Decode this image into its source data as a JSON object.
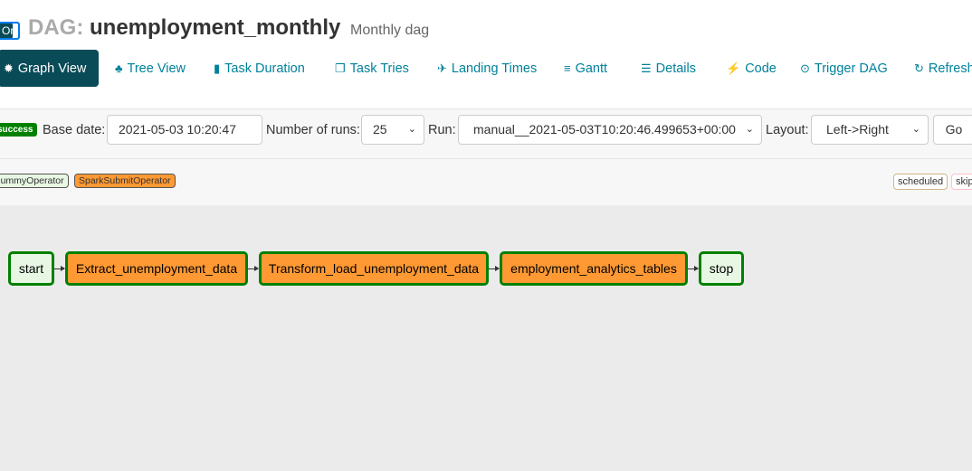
{
  "header": {
    "toggle_label": "On",
    "dag_prefix": "DAG:",
    "dag_id": "unemployment_monthly",
    "description": "Monthly dag"
  },
  "nav": {
    "items": [
      {
        "label": "Graph View",
        "icon": "gear-icon"
      },
      {
        "label": "Tree View",
        "icon": "tree-icon"
      },
      {
        "label": "Task Duration",
        "icon": "bar-chart-icon"
      },
      {
        "label": "Task Tries",
        "icon": "copy-icon"
      },
      {
        "label": "Landing Times",
        "icon": "plane-icon"
      },
      {
        "label": "Gantt",
        "icon": "align-left-icon"
      },
      {
        "label": "Details",
        "icon": "list-icon"
      },
      {
        "label": "Code",
        "icon": "bolt-icon"
      },
      {
        "label": "Trigger DAG",
        "icon": "play-circle-icon"
      },
      {
        "label": "Refresh",
        "icon": "refresh-icon"
      }
    ]
  },
  "controls": {
    "state_badge": "success",
    "base_date_label": "Base date:",
    "base_date_value": "2021-05-03 10:20:47",
    "num_runs_label": "Number of runs:",
    "num_runs_value": "25",
    "run_label": "Run:",
    "run_value": "manual__2021-05-03T10:20:46.499653+00:00",
    "layout_label": "Layout:",
    "layout_value": "Left->Right",
    "go_label": "Go"
  },
  "legend": {
    "operators": [
      {
        "label": "DummyOperator",
        "color": "#e8f7e4"
      },
      {
        "label": "SparkSubmitOperator",
        "color": "#ff9933"
      }
    ],
    "states": [
      {
        "label": "scheduled",
        "color": "#d2b48c"
      },
      {
        "label": "skipped",
        "color": "#ffc0cb"
      }
    ]
  },
  "graph": {
    "nodes": [
      {
        "label": "start",
        "color": "#e8f7e4"
      },
      {
        "label": "Extract_unemployment_data",
        "color": "#ff9933"
      },
      {
        "label": "Transform_load_unemployment_data",
        "color": "#ff9933"
      },
      {
        "label": "employment_analytics_tables",
        "color": "#ff9933"
      },
      {
        "label": "stop",
        "color": "#e8f7e4"
      }
    ],
    "success_border": "#008000"
  },
  "colors": {
    "nav_active_bg": "#0a4b58",
    "nav_link": "#00819b",
    "graph_bg": "#ebebeb"
  }
}
